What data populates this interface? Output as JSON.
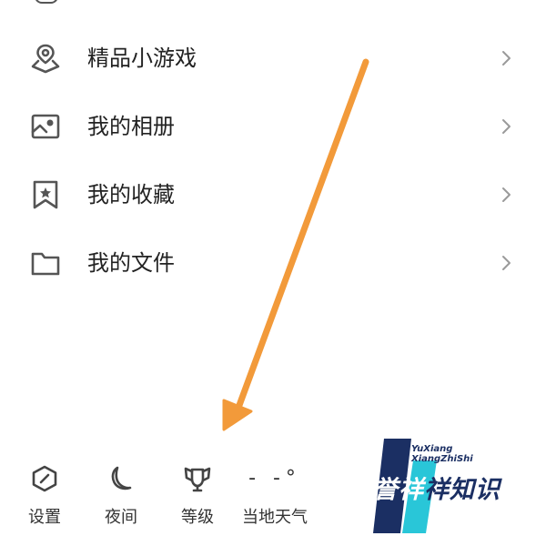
{
  "menu": {
    "items": [
      {
        "label": "精品小游戏",
        "icon": "game-location-icon"
      },
      {
        "label": "我的相册",
        "icon": "photo-album-icon"
      },
      {
        "label": "我的收藏",
        "icon": "bookmark-star-icon"
      },
      {
        "label": "我的文件",
        "icon": "folder-icon"
      }
    ]
  },
  "bottom_bar": {
    "items": [
      {
        "label": "设置",
        "icon": "settings-hexagon-icon"
      },
      {
        "label": "夜间",
        "icon": "moon-icon"
      },
      {
        "label": "等级",
        "icon": "level-trophy-icon"
      },
      {
        "label": "当地天气",
        "icon": "weather-temperature",
        "value": "- -°"
      }
    ]
  },
  "watermark": {
    "english_line1": "YuXiang",
    "english_line2": "XiangZhiShi",
    "chinese_part1": "誉祥",
    "chinese_part2": "祥知识"
  },
  "colors": {
    "arrow": "#f29a3a",
    "icon_gray": "#555555",
    "text": "#222222",
    "logo_navy": "#1b2f63",
    "logo_cyan": "#29c6d8"
  }
}
